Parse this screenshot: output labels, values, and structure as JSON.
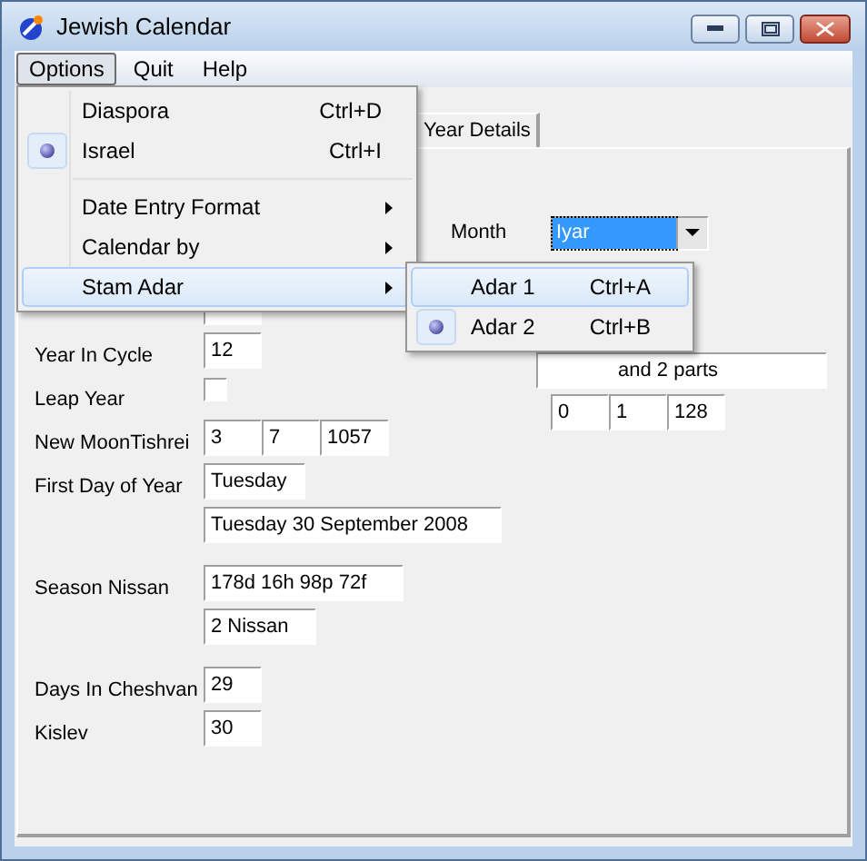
{
  "window": {
    "title": "Jewish Calendar"
  },
  "menu_bar": [
    {
      "label": "Options",
      "selected": true
    },
    {
      "label": "Quit",
      "selected": false
    },
    {
      "label": "Help",
      "selected": false
    }
  ],
  "options_menu": [
    {
      "kind": "item",
      "label": "Diaspora",
      "shortcut": "Ctrl+D",
      "checked": false,
      "highlighted": false
    },
    {
      "kind": "item",
      "label": "Israel",
      "shortcut": "Ctrl+I",
      "checked": true,
      "highlighted": false
    },
    {
      "kind": "separator"
    },
    {
      "kind": "submenu",
      "label": "Date Entry Format",
      "highlighted": false
    },
    {
      "kind": "submenu",
      "label": "Calendar by",
      "highlighted": false
    },
    {
      "kind": "submenu",
      "label": "Stam Adar",
      "highlighted": true
    }
  ],
  "submenu": [
    {
      "label": "Adar 1",
      "shortcut": "Ctrl+A",
      "checked": false,
      "highlighted": true
    },
    {
      "label": "Adar 2",
      "shortcut": "Ctrl+B",
      "checked": true,
      "highlighted": false
    }
  ],
  "tabs": [
    {
      "label": "Year Details",
      "selected": true
    }
  ],
  "month": {
    "label": "Month",
    "value": "Iyar"
  },
  "left_groups": [
    [
      {
        "kind": "fields",
        "label": "Year In Cycle",
        "values": [
          "12"
        ]
      },
      {
        "kind": "checkbox",
        "label": "Leap Year",
        "checked": false
      },
      {
        "kind": "fields",
        "label": "New MoonTishrei",
        "values": [
          "3",
          "7",
          "1057"
        ]
      },
      {
        "kind": "fields",
        "label": "First Day of Year",
        "values": [
          "Tuesday"
        ]
      },
      {
        "kind": "fields",
        "values": [
          "Tuesday 30 September 2008"
        ]
      }
    ],
    [
      {
        "kind": "fields",
        "label": "Season Nissan",
        "values": [
          "178d 16h 98p 72f"
        ]
      },
      {
        "kind": "fields",
        "values": [
          "2 Nissan"
        ]
      }
    ],
    [
      {
        "kind": "fields",
        "label": "Days In Cheshvan",
        "values": [
          "29"
        ]
      },
      {
        "kind": "fields",
        "label": "Kislev",
        "values": [
          "30"
        ]
      }
    ]
  ],
  "right_fields": {
    "molad": "and 2 parts",
    "values": [
      "0",
      "1",
      "128"
    ]
  }
}
